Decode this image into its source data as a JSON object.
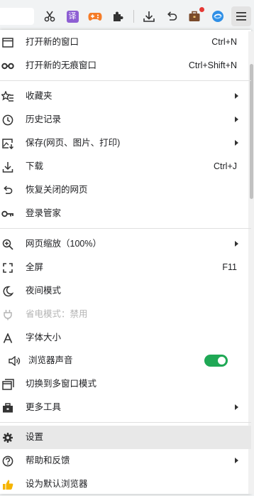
{
  "toolbar": {
    "icons": [
      "cut-icon",
      "translate-icon",
      "game-icon",
      "extensions-icon",
      "download-icon",
      "undo-icon",
      "briefcase-icon",
      "browser-logo-icon",
      "menu-icon"
    ],
    "translate_glyph": "译",
    "accent_color": "#1fa855"
  },
  "menu": {
    "new_window": {
      "label": "打开新的窗口",
      "shortcut": "Ctrl+N"
    },
    "incognito": {
      "label": "打开新的无痕窗口",
      "shortcut": "Ctrl+Shift+N"
    },
    "bookmarks": {
      "label": "收藏夹"
    },
    "history": {
      "label": "历史记录"
    },
    "save": {
      "label": "保存(网页、图片、打印)"
    },
    "downloads": {
      "label": "下载",
      "shortcut": "Ctrl+J"
    },
    "reopen": {
      "label": "恢复关闭的网页"
    },
    "passwords": {
      "label": "登录管家"
    },
    "zoom": {
      "label": "网页缩放（100%）"
    },
    "fullscreen": {
      "label": "全屏",
      "shortcut": "F11"
    },
    "night": {
      "label": "夜间模式"
    },
    "power_save": {
      "label": "省电模式：禁用"
    },
    "font_size": {
      "label": "字体大小"
    },
    "sound": {
      "label": "浏览器声音",
      "enabled": true
    },
    "multi_window": {
      "label": "切换到多窗口模式"
    },
    "more_tools": {
      "label": "更多工具"
    },
    "settings": {
      "label": "设置"
    },
    "help": {
      "label": "帮助和反馈"
    },
    "default_browser": {
      "label": "设为默认浏览器"
    }
  }
}
